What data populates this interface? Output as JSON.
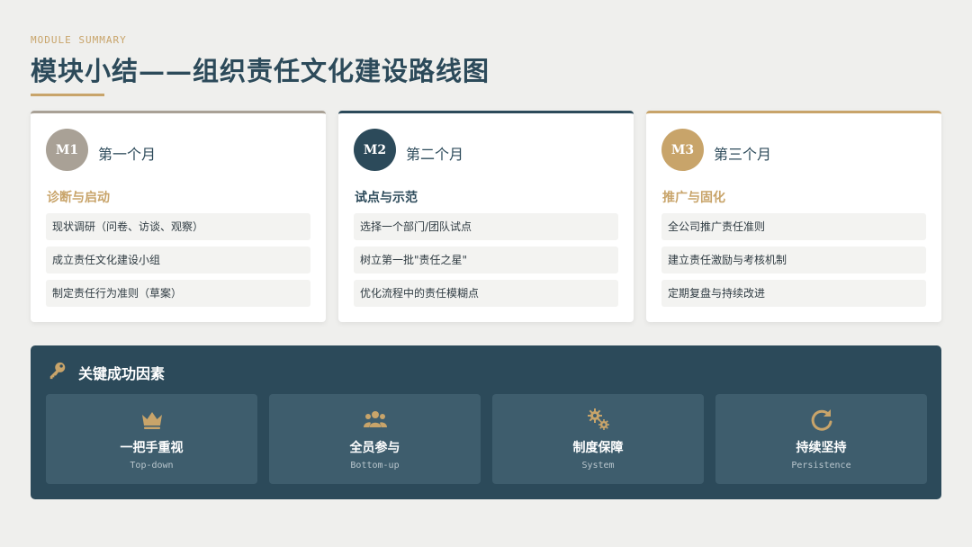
{
  "header": {
    "eyebrow": "MODULE SUMMARY",
    "title": "模块小结——组织责任文化建设路线图"
  },
  "colors": {
    "primary": "#2c4a5a",
    "gold": "#c8a46a",
    "taupe": "#a9a196",
    "background": "#efefed"
  },
  "months": [
    {
      "badge": "M1",
      "label": "第一个月",
      "phase": "诊断与启动",
      "items": [
        "现状调研（问卷、访谈、观察）",
        "成立责任文化建设小组",
        "制定责任行为准则（草案）"
      ]
    },
    {
      "badge": "M2",
      "label": "第二个月",
      "phase": "试点与示范",
      "items": [
        "选择一个部门/团队试点",
        "树立第一批\"责任之星\"",
        "优化流程中的责任模糊点"
      ]
    },
    {
      "badge": "M3",
      "label": "第三个月",
      "phase": "推广与固化",
      "items": [
        "全公司推广责任准则",
        "建立责任激励与考核机制",
        "定期复盘与持续改进"
      ]
    }
  ],
  "factors": {
    "title": "关键成功因素",
    "title_icon": "key-icon",
    "items": [
      {
        "name": "一把手重视",
        "sub": "Top-down",
        "icon": "crown-icon"
      },
      {
        "name": "全员参与",
        "sub": "Bottom-up",
        "icon": "users-icon"
      },
      {
        "name": "制度保障",
        "sub": "System",
        "icon": "gears-icon"
      },
      {
        "name": "持续坚持",
        "sub": "Persistence",
        "icon": "redo-icon"
      }
    ]
  }
}
